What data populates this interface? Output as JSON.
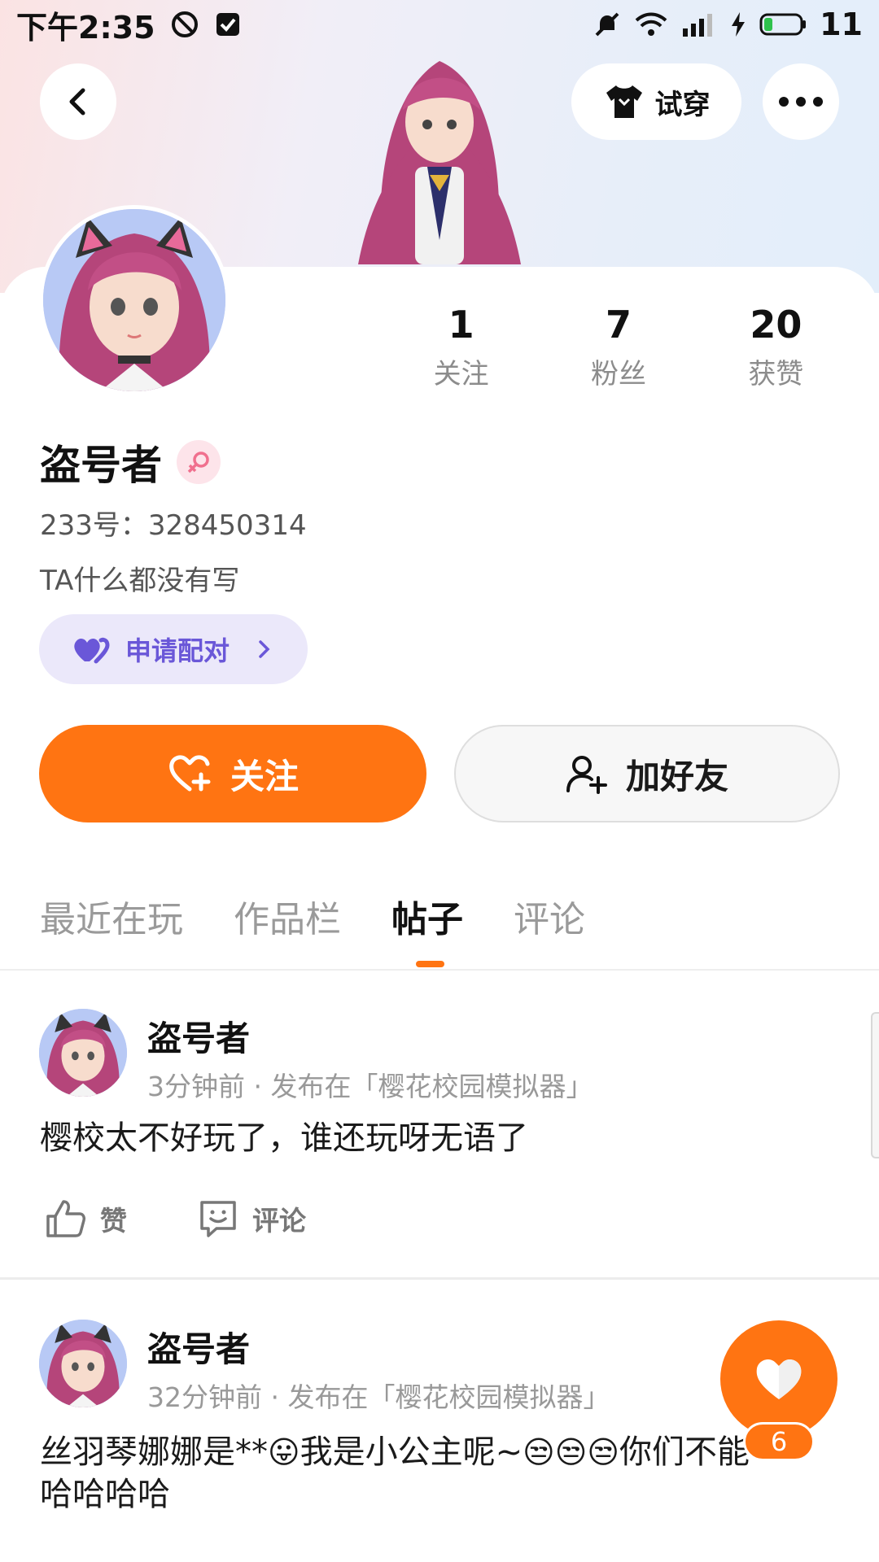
{
  "status_bar": {
    "time": "下午2:35",
    "battery": "11",
    "network": "4G"
  },
  "header": {
    "try_on_label": "试穿"
  },
  "profile": {
    "nickname": "盗号者",
    "user_id": "233号：328450314",
    "bio": "TA什么都没有写",
    "pair_label": "申请配对",
    "gender": "female"
  },
  "stats": [
    {
      "value": "1",
      "label": "关注"
    },
    {
      "value": "7",
      "label": "粉丝"
    },
    {
      "value": "20",
      "label": "获赞"
    }
  ],
  "actions": {
    "follow_label": "关注",
    "add_friend_label": "加好友"
  },
  "tabs": [
    {
      "label": "最近在玩",
      "active": false
    },
    {
      "label": "作品栏",
      "active": false
    },
    {
      "label": "帖子",
      "active": true
    },
    {
      "label": "评论",
      "active": false
    }
  ],
  "posts": [
    {
      "author": "盗号者",
      "meta": "3分钟前 · 发布在「樱花校园模拟器」",
      "text": "樱校太不好玩了，谁还玩呀无语了",
      "like_label": "赞",
      "comment_label": "评论"
    },
    {
      "author": "盗号者",
      "meta": "32分钟前 · 发布在「樱花校园模拟器」",
      "text_parts": [
        "丝羽琴娜娜是**",
        "😛",
        "我是小公主呢~",
        "😒😒😒",
        "你们不能",
        "哈哈哈哈"
      ]
    }
  ],
  "fab": {
    "count": "6"
  },
  "colors": {
    "accent": "#ff7412",
    "pair_bg": "#ebe8fa",
    "pair_text": "#6a57d8"
  }
}
